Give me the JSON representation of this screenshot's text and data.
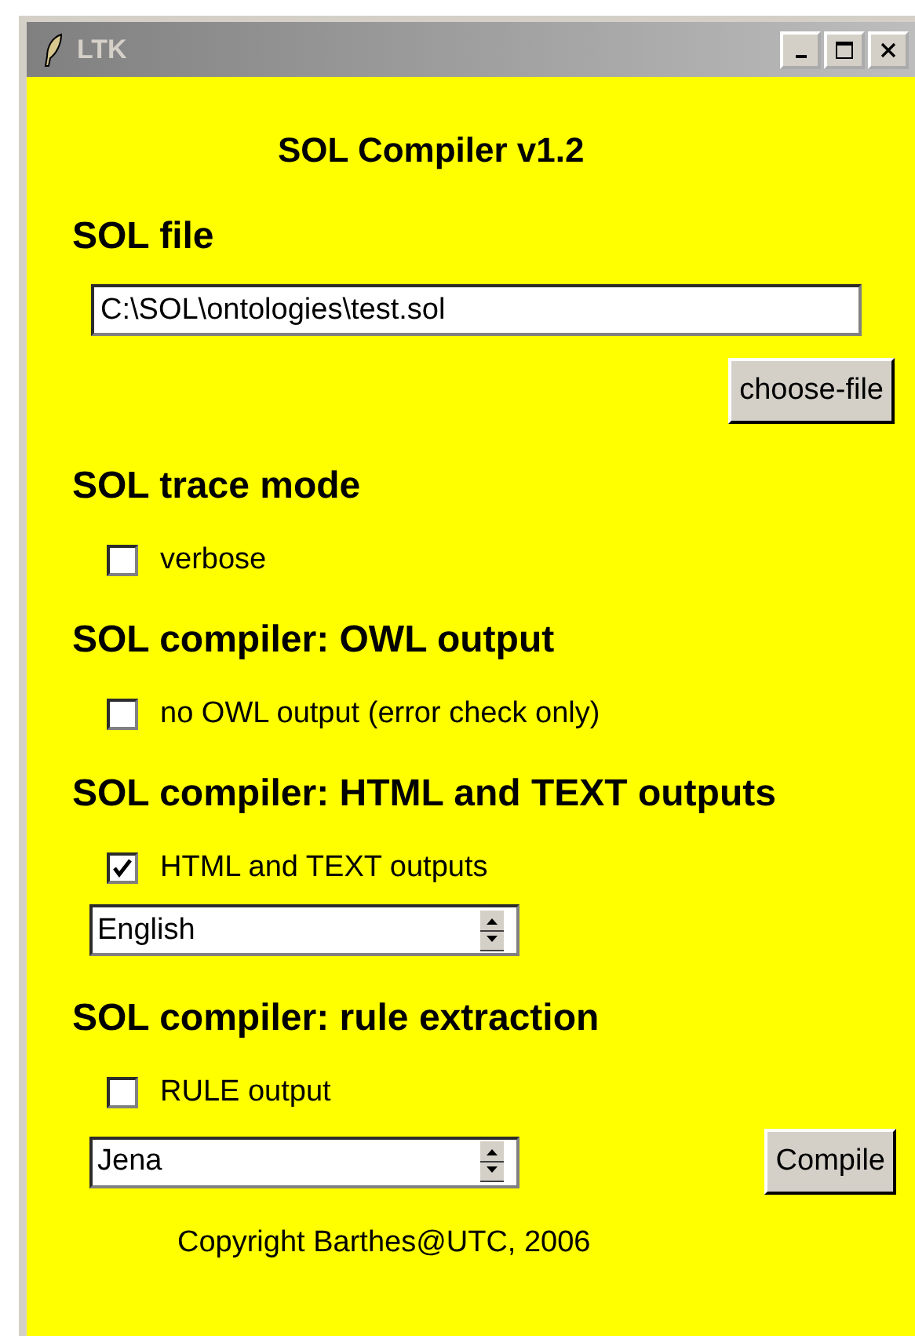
{
  "window": {
    "title": "LTK"
  },
  "heading": "SOL Compiler v1.2",
  "sections": [
    {
      "title": "SOL file",
      "items": [
        {
          "kind": "entry",
          "value": "C:\\SOL\\ontologies\\test.sol"
        },
        {
          "kind": "button",
          "label": "choose-file"
        }
      ]
    },
    {
      "title": "SOL trace mode",
      "items": [
        {
          "kind": "checkbox",
          "label": "verbose",
          "checked": false
        }
      ]
    },
    {
      "title": "SOL compiler: OWL output",
      "items": [
        {
          "kind": "checkbox",
          "label": "no OWL output (error check only)",
          "checked": false
        }
      ]
    },
    {
      "title": "SOL compiler: HTML and TEXT outputs",
      "items": [
        {
          "kind": "checkbox",
          "label": "HTML and TEXT outputs",
          "checked": true
        },
        {
          "kind": "spinbox",
          "value": "English"
        }
      ]
    },
    {
      "title": "SOL compiler: rule extraction",
      "items": [
        {
          "kind": "checkbox",
          "label": "RULE output",
          "checked": false
        },
        {
          "kind": "spinbox",
          "value": "Jena",
          "button": "Compile"
        }
      ]
    }
  ],
  "copyright": "Copyright Barthes@UTC, 2006"
}
